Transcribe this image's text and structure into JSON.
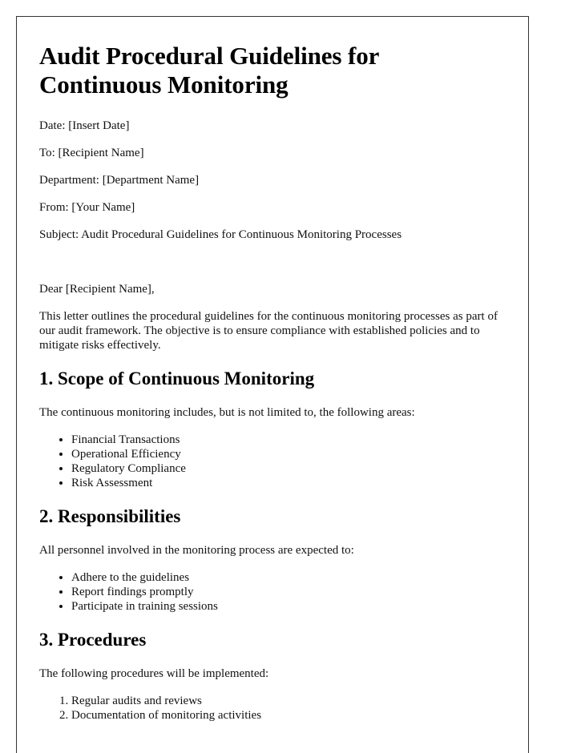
{
  "document": {
    "title": "Audit Procedural Guidelines for Continuous Monitoring",
    "fields": [
      {
        "label": "Date:",
        "value": "[Insert Date]"
      },
      {
        "label": "To:",
        "value": "[Recipient Name]"
      },
      {
        "label": "Department:",
        "value": "[Department Name]"
      },
      {
        "label": "From:",
        "value": "[Your Name]"
      },
      {
        "label": "Subject:",
        "value": "Audit Procedural Guidelines for Continuous Monitoring Processes"
      }
    ],
    "fields_text": [
      "Date: [Insert Date]",
      "To: [Recipient Name]",
      "Department: [Department Name]",
      "From: [Your Name]",
      "Subject: Audit Procedural Guidelines for Continuous Monitoring Processes"
    ],
    "salutation": "Dear [Recipient Name],",
    "intro": "This letter outlines the procedural guidelines for the continuous monitoring processes as part of our audit framework. The objective is to ensure compliance with established policies and to mitigate risks effectively.",
    "sections": [
      {
        "heading": "1. Scope of Continuous Monitoring",
        "intro": "The continuous monitoring includes, but is not limited to, the following areas:",
        "list_type": "bullet",
        "items": [
          "Financial Transactions",
          "Operational Efficiency",
          "Regulatory Compliance",
          "Risk Assessment"
        ]
      },
      {
        "heading": "2. Responsibilities",
        "intro": "All personnel involved in the monitoring process are expected to:",
        "list_type": "bullet",
        "items": [
          "Adhere to the guidelines",
          "Report findings promptly",
          "Participate in training sessions"
        ]
      },
      {
        "heading": "3. Procedures",
        "intro": "The following procedures will be implemented:",
        "list_type": "numbered",
        "items": [
          "Regular audits and reviews",
          "Documentation of monitoring activities"
        ]
      }
    ]
  }
}
